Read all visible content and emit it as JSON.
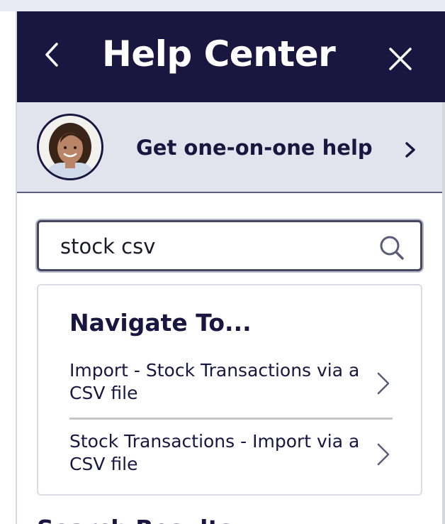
{
  "header": {
    "title": "Help Center",
    "back_icon": "chevron-left-icon",
    "close_icon": "close-icon"
  },
  "help_banner": {
    "label": "Get one-on-one help",
    "avatar": "agent-avatar",
    "chevron_icon": "chevron-right-icon"
  },
  "search": {
    "value": "stock csv",
    "icon": "search-icon"
  },
  "navigate": {
    "heading": "Navigate To...",
    "items": [
      {
        "label": "Import - Stock Transactions via a CSV file"
      },
      {
        "label": "Stock Transactions - Import via a CSV file"
      }
    ]
  },
  "results": {
    "heading": "Search Results"
  },
  "colors": {
    "header_bg": "#191640",
    "banner_bg": "#e3e3ee",
    "text_dark": "#191640"
  }
}
